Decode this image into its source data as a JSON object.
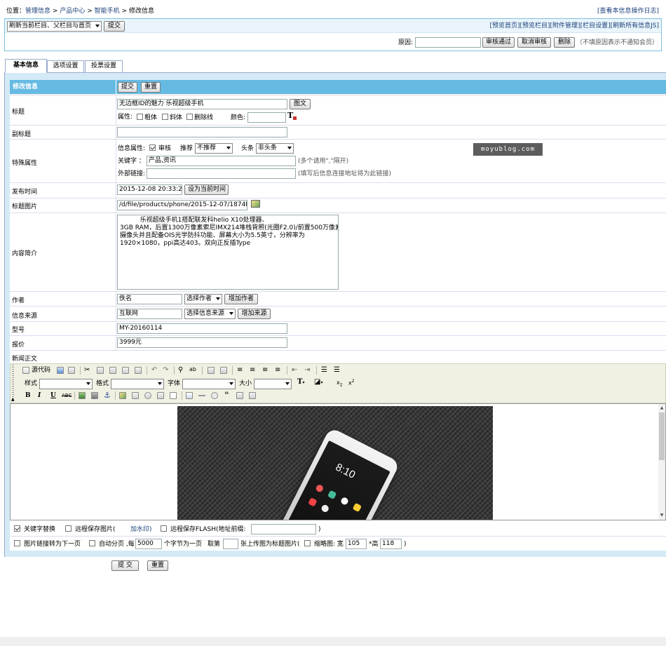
{
  "breadcrumb": {
    "prefix": "位置：",
    "items": [
      "管理信息",
      "产品中心",
      "智能手机",
      "修改信息"
    ],
    "sep": ">",
    "log_link": "[查看本信息操作日志]"
  },
  "toolbar": {
    "refresh_select": "刷新当前栏目、父栏目与首页",
    "submit": "提交",
    "links": [
      "[预览首页]",
      "[预览栏目]",
      "[附件管理]",
      "[栏目设置]",
      "[刷新所有信息JS]"
    ]
  },
  "audit": {
    "reason_label": "原因:",
    "approve": "审核通过",
    "cancel": "取消审核",
    "delete": "删除",
    "hint": "（不填原因表示不通知会员）"
  },
  "tabs": [
    "基本信息",
    "选项设置",
    "投票设置"
  ],
  "form": {
    "header_title": "修改信息",
    "submit": "提交",
    "reset": "重置",
    "title": {
      "label": "标题",
      "value": "无边框ID的魅力 乐视超级手机",
      "image_btn": "图文",
      "attr_label": "属性:",
      "bold": "粗体",
      "italic": "斜体",
      "strike": "删除线",
      "color_label": "颜色:"
    },
    "subtitle": {
      "label": "副标题",
      "value": ""
    },
    "special": {
      "label": "特殊属性",
      "info_attr_label": "信息属性:",
      "audit": "审核",
      "recommend_label": "推荐",
      "recommend_value": "不推荐",
      "headline_label": "头条",
      "headline_value": "非头条",
      "keywords_label": "关键字 ：",
      "keywords_value": "产品,资讯",
      "keywords_hint": "(多个请用\",\"隔开)",
      "external_label": "外部链接:",
      "external_value": "",
      "external_hint": "(填写后信息连接地址将为此链接)"
    },
    "publish_time": {
      "label": "发布时间",
      "value": "2015-12-08 20:33:22",
      "btn": "设为当前时间"
    },
    "title_pic": {
      "label": "标题图片",
      "value": "/d/file/products/phone/2015-12-07/1874fd1"
    },
    "summary": {
      "label": "内容简介",
      "value": "          乐视超级手机1搭配联发科helio X10处理器、\n3GB RAM，后置1300万像素索尼IMX214堆栈背照(光圈F2.0)/前置500万像素\n摄像头并且配备OIS光学防抖功能、屏幕大小为5.5英寸，分辨率为\n1920×1080，ppi高达403。双向正反插Type"
    },
    "author": {
      "label": "作者",
      "value": "佚名",
      "select": "选择作者",
      "add": "增加作者"
    },
    "source": {
      "label": "信息来源",
      "value": "互联网",
      "select": "选择信息来源",
      "add": "增加来源"
    },
    "model": {
      "label": "型号",
      "value": "MY-20160114"
    },
    "price": {
      "label": "报价",
      "value": "3999元"
    },
    "body": {
      "label": "新闻正文"
    }
  },
  "editor": {
    "source": "源代码",
    "style_label": "样式",
    "format_label": "格式",
    "font_label": "字体",
    "size_label": "大小"
  },
  "options": {
    "keyword_replace": "关键字替换",
    "remote_save": "远程保存图片(",
    "watermark": "加水印)",
    "remote_flash": "远程保存FLASH(地址前缀:",
    "close_paren": ")",
    "img_link_next": "图片链接转为下一页",
    "auto_page": "自动分页 ,每",
    "page_chars": "5000",
    "chars_suffix": "个字节为一页",
    "take_label": "取第",
    "take_suffix": "张上传图为标题图片(",
    "thumb_label": "缩略图: 宽",
    "thumb_width": "105",
    "thumb_height_label": "*高",
    "thumb_height": "118",
    "thumb_close": ")"
  },
  "bottom": {
    "submit": "提 交",
    "reset": "重置"
  },
  "watermark": "moyublog.com",
  "colors": {
    "accent": "#6cbbe0",
    "tab_bg": "#e8f4fb",
    "link": "#1a3f7a"
  }
}
